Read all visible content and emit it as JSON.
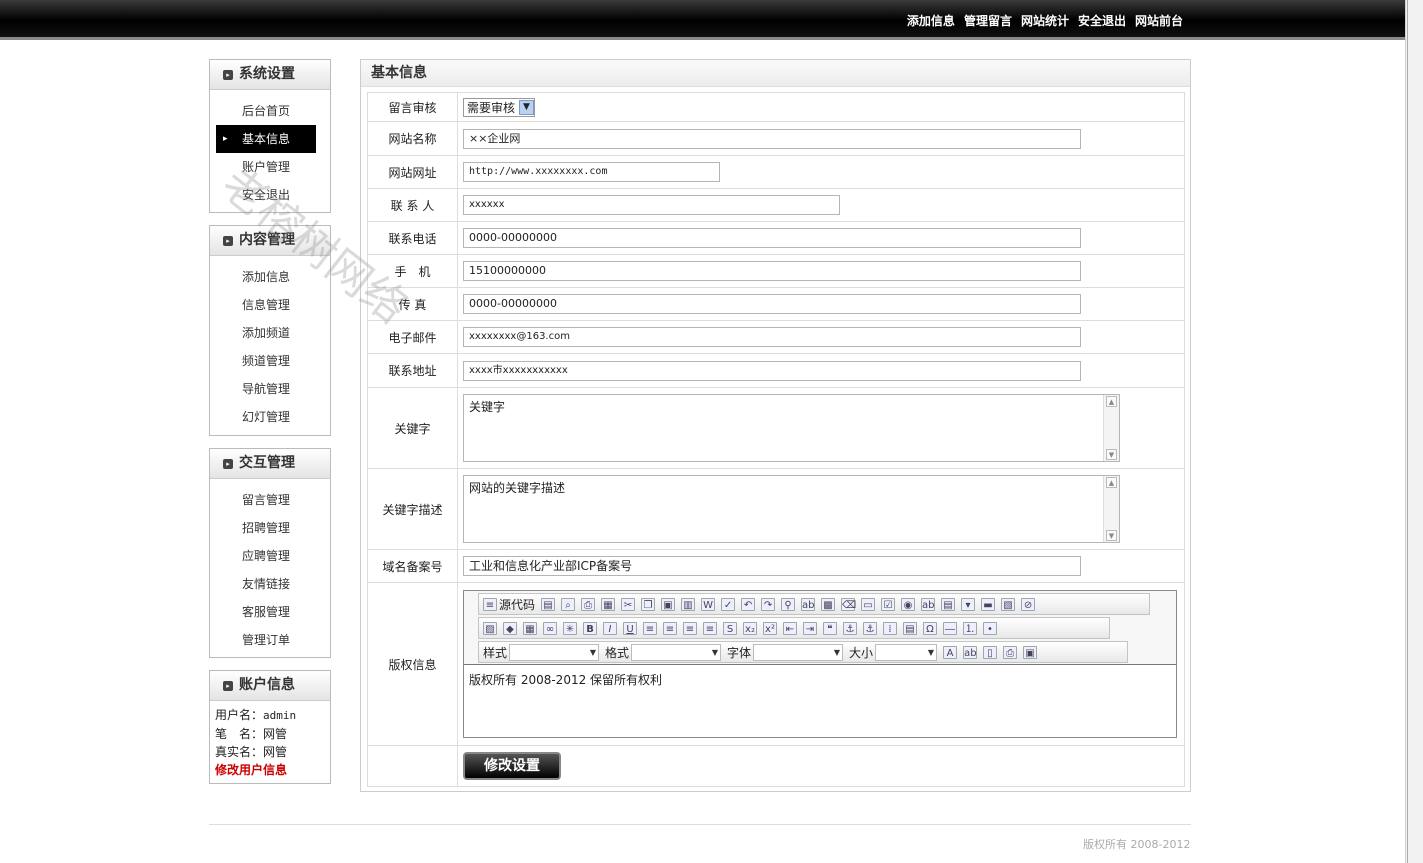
{
  "topnav": [
    "添加信息",
    "管理留言",
    "网站统计",
    "安全退出",
    "网站前台"
  ],
  "sidebar": {
    "system": {
      "title": "系统设置",
      "items": [
        "后台首页",
        "基本信息",
        "账户管理",
        "安全退出"
      ]
    },
    "content": {
      "title": "内容管理",
      "items": [
        "添加信息",
        "信息管理",
        "添加频道",
        "频道管理",
        "导航管理",
        "幻灯管理"
      ]
    },
    "interact": {
      "title": "交互管理",
      "items": [
        "留言管理",
        "招聘管理",
        "应聘管理",
        "友情链接",
        "客服管理",
        "管理订单"
      ]
    },
    "account": {
      "title": "账户信息",
      "username_label": "用户名：",
      "username": "admin",
      "nickname_label": "笔　名：",
      "nickname": "网管",
      "realname_label": "真实名：",
      "realname": "网管",
      "edit_link": "修改用户信息"
    }
  },
  "main": {
    "title": "基本信息",
    "fields": {
      "review_label": "留言审核",
      "review_value": "需要审核",
      "sitename_label": "网站名称",
      "sitename_value": "××企业网",
      "siteurl_label": "网站网址",
      "siteurl_value": "http://www.xxxxxxxx.com",
      "contact_label": "联 系 人",
      "contact_value": "xxxxxx",
      "phone_label": "联系电话",
      "phone_value": "0000-00000000",
      "mobile_label": "手　机",
      "mobile_value": "15100000000",
      "fax_label": "传 真",
      "fax_value": "0000-00000000",
      "email_label": "电子邮件",
      "email_value": "xxxxxxxx@163.com",
      "address_label": "联系地址",
      "address_value": "xxxx市xxxxxxxxxxx",
      "keywords_label": "关键字",
      "keywords_value": "关键字",
      "description_label": "关键字描述",
      "description_value": "网站的关键字描述",
      "icp_label": "域名备案号",
      "icp_value": "工业和信息化产业部ICP备案号",
      "copyright_label": "版权信息",
      "copyright_value": "版权所有  2008-2012 保留所有权利"
    },
    "editor": {
      "source_label": "源代码",
      "style_label": "样式",
      "format_label": "格式",
      "font_label": "字体",
      "size_label": "大小"
    },
    "submit_label": "修改设置"
  },
  "footer": "版权所有 2008-2012",
  "watermark": "老榕树网络"
}
